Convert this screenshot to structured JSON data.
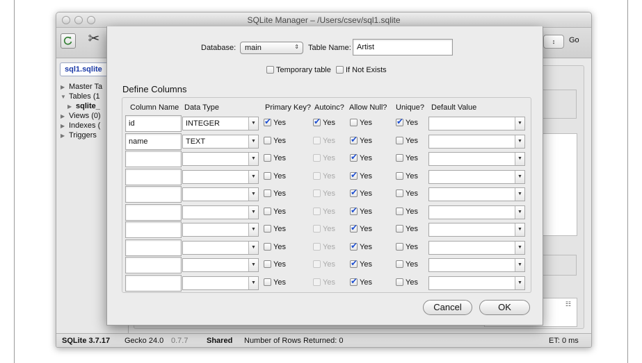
{
  "window": {
    "title": "SQLite Manager – /Users/csev/sql1.sqlite"
  },
  "toolbar": {
    "go_label": "Go",
    "refresh_icon": "refresh-icon",
    "tools_icon": "scissors-tools-icon",
    "caret": "↕"
  },
  "sidebar": {
    "db_tab": "sql1.sqlite",
    "items": [
      {
        "label": "Master Ta",
        "expanded": false
      },
      {
        "label": "Tables (1",
        "expanded": true
      },
      {
        "label": "sqlite_",
        "child": true
      },
      {
        "label": "Views (0)",
        "expanded": false
      },
      {
        "label": "Indexes (",
        "expanded": false
      },
      {
        "label": "Triggers",
        "expanded": false
      }
    ]
  },
  "status": {
    "sqlite_version": "SQLite 3.7.17",
    "gecko": "Gecko 24.0",
    "ext_version": "0.7.7",
    "shared": "Shared",
    "rows": "Number of Rows Returned: 0",
    "et": "ET: 0 ms"
  },
  "dialog": {
    "database_label": "Database:",
    "database_value": "main",
    "table_name_label": "Table Name:",
    "table_name_value": "Artist",
    "temporary_table": "Temporary table",
    "if_not_exists": "If Not Exists",
    "define_columns": "Define Columns",
    "headers": [
      "Column Name",
      "Data Type",
      "Primary Key?",
      "Autoinc?",
      "Allow Null?",
      "Unique?",
      "Default Value"
    ],
    "yes": "Yes",
    "cancel": "Cancel",
    "ok": "OK",
    "rows": [
      {
        "name": "id",
        "type": "INTEGER",
        "pk": true,
        "autoinc": true,
        "autoinc_enabled": true,
        "null": false,
        "unique": true
      },
      {
        "name": "name",
        "type": "TEXT",
        "pk": false,
        "autoinc": false,
        "autoinc_enabled": false,
        "null": true,
        "unique": false
      },
      {
        "name": "",
        "type": "",
        "pk": false,
        "autoinc": false,
        "autoinc_enabled": false,
        "null": true,
        "unique": false
      },
      {
        "name": "",
        "type": "",
        "pk": false,
        "autoinc": false,
        "autoinc_enabled": false,
        "null": true,
        "unique": false
      },
      {
        "name": "",
        "type": "",
        "pk": false,
        "autoinc": false,
        "autoinc_enabled": false,
        "null": true,
        "unique": false
      },
      {
        "name": "",
        "type": "",
        "pk": false,
        "autoinc": false,
        "autoinc_enabled": false,
        "null": true,
        "unique": false
      },
      {
        "name": "",
        "type": "",
        "pk": false,
        "autoinc": false,
        "autoinc_enabled": false,
        "null": true,
        "unique": false
      },
      {
        "name": "",
        "type": "",
        "pk": false,
        "autoinc": false,
        "autoinc_enabled": false,
        "null": true,
        "unique": false
      },
      {
        "name": "",
        "type": "",
        "pk": false,
        "autoinc": false,
        "autoinc_enabled": false,
        "null": true,
        "unique": false
      },
      {
        "name": "",
        "type": "",
        "pk": false,
        "autoinc": false,
        "autoinc_enabled": false,
        "null": true,
        "unique": false
      }
    ]
  }
}
